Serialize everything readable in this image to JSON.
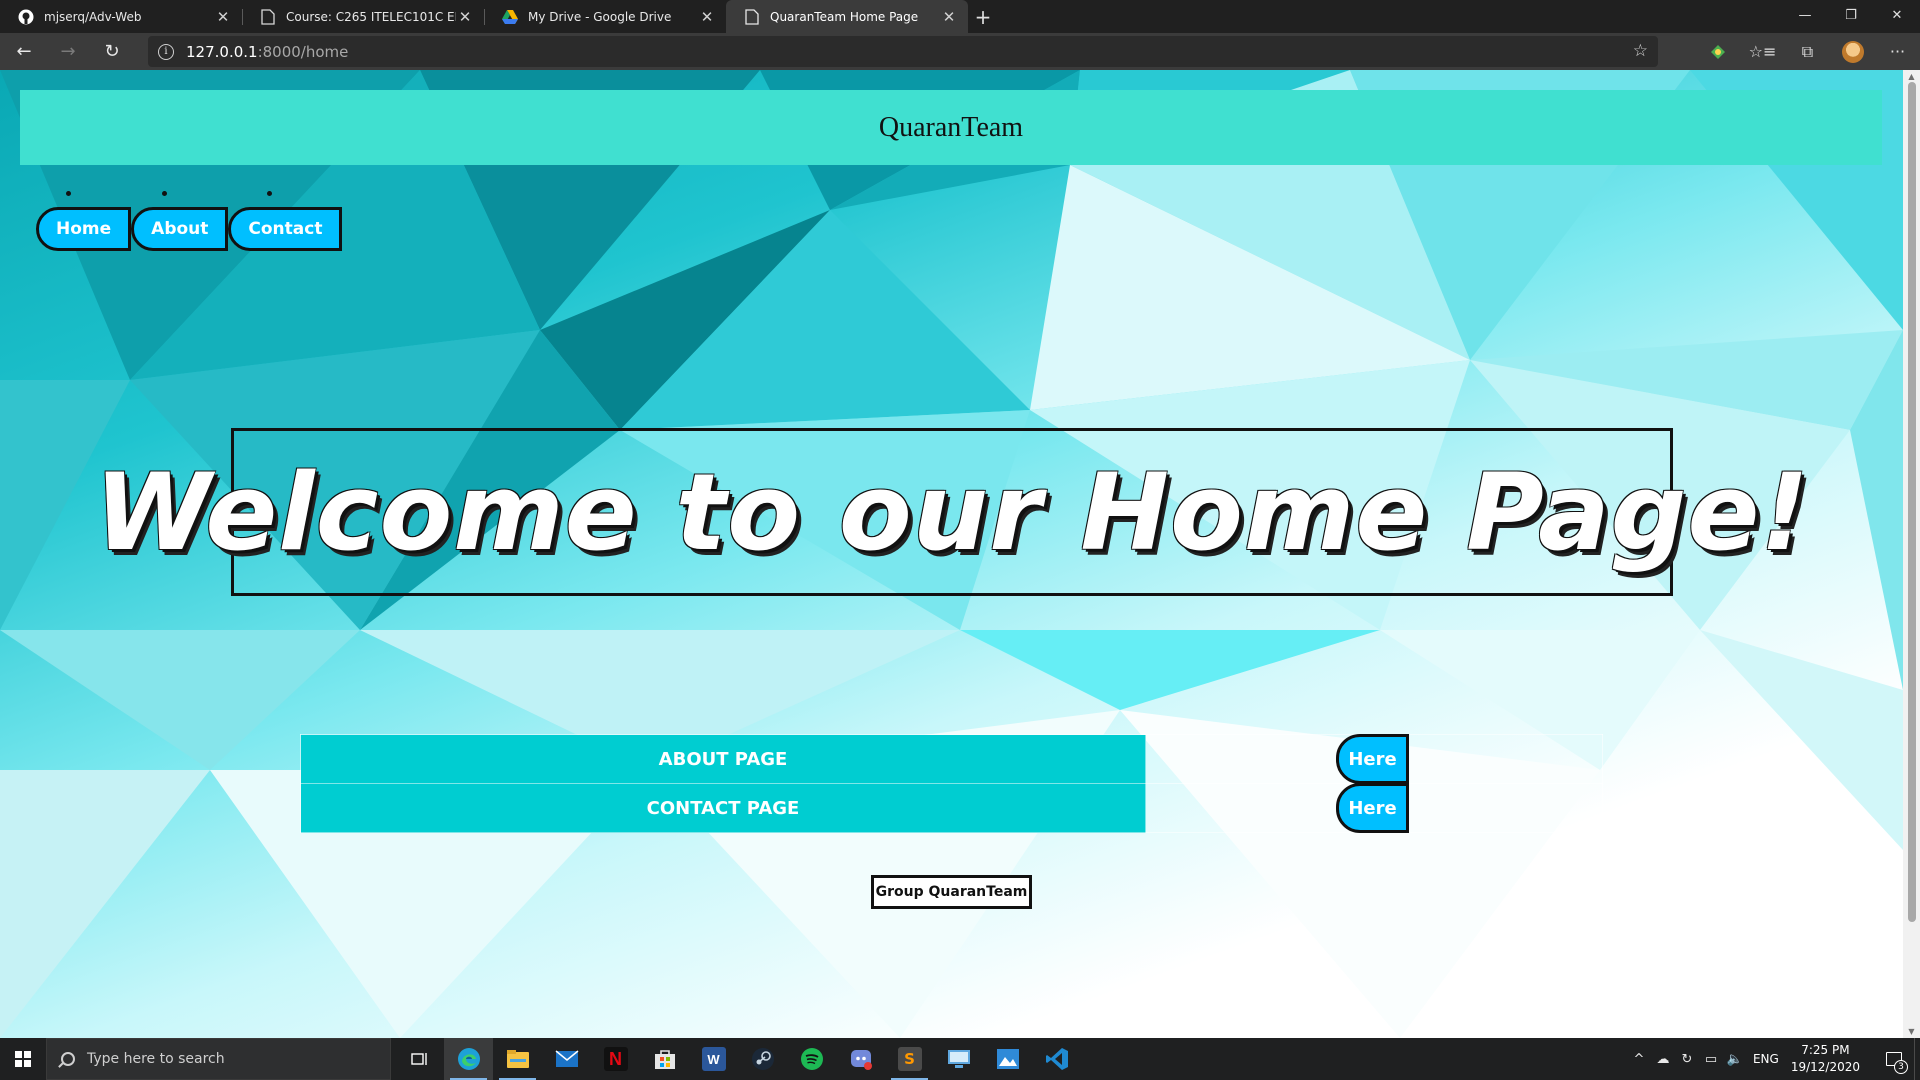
{
  "browser": {
    "tabs": [
      {
        "title": "mjserq/Adv-Web",
        "icon": "github-icon",
        "active": false
      },
      {
        "title": "Course: C265 ITELEC101C ELECTI",
        "icon": "page-icon",
        "active": false
      },
      {
        "title": "My Drive - Google Drive",
        "icon": "google-drive-icon",
        "active": false
      },
      {
        "title": "QuaranTeam Home Page",
        "icon": "page-icon",
        "active": true
      }
    ],
    "address": {
      "host": "127.0.0.1",
      "path": ":8000/home"
    }
  },
  "page": {
    "header_title": "QuaranTeam",
    "nav": [
      {
        "label": "Home"
      },
      {
        "label": "About"
      },
      {
        "label": "Contact"
      }
    ],
    "welcome_text": "Welcome to our Home Page!",
    "links_table": [
      {
        "label": "ABOUT PAGE",
        "button": "Here"
      },
      {
        "label": "CONTACT PAGE",
        "button": "Here"
      }
    ],
    "footer": "Group QuaranTeam",
    "colors": {
      "header_bg": "#40e0d0",
      "nav_button": "#00bfff",
      "table_label_bg": "#00cdd1"
    }
  },
  "taskbar": {
    "search_placeholder": "Type here to search",
    "apps": [
      "task-view-icon",
      "edge-icon",
      "file-explorer-icon",
      "mail-icon",
      "netflix-icon",
      "store-icon",
      "word-icon",
      "steam-icon",
      "spotify-icon",
      "discord-icon",
      "sublime-text-icon",
      "remote-desktop-icon",
      "photos-icon",
      "vscode-icon"
    ],
    "language": "ENG",
    "time": "7:25 PM",
    "date": "19/12/2020",
    "notification_count": "3"
  }
}
